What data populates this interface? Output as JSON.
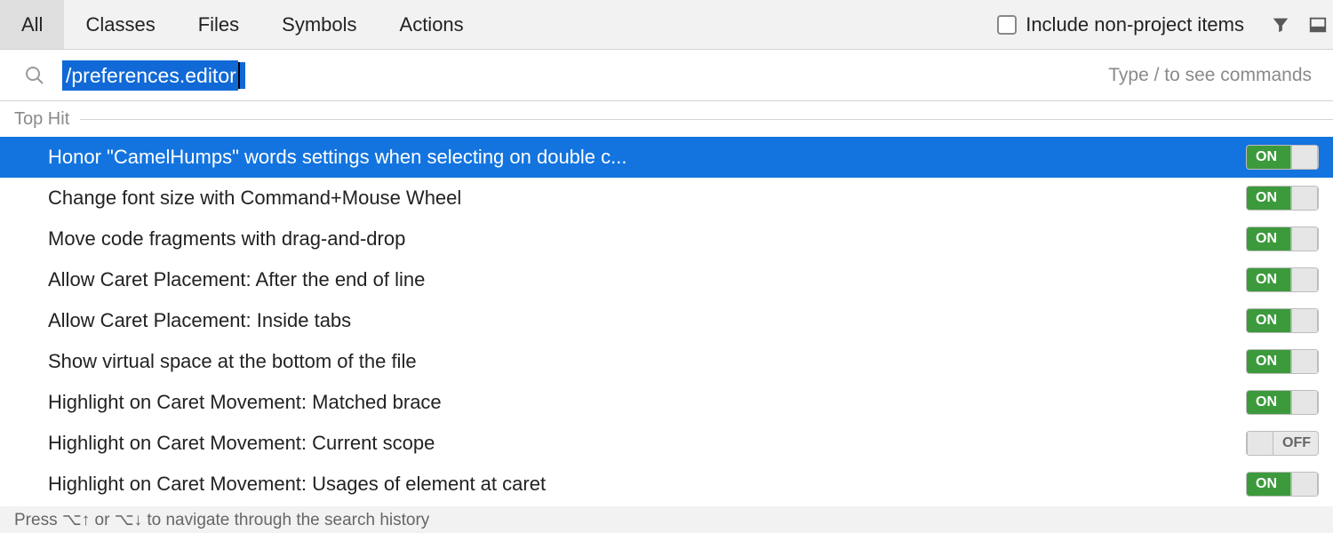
{
  "tabs": [
    "All",
    "Classes",
    "Files",
    "Symbols",
    "Actions"
  ],
  "active_tab": 0,
  "include": {
    "label": "Include non-project items",
    "checked": false
  },
  "search": {
    "query": "/preferences.editor",
    "hint": "Type / to see commands"
  },
  "section": "Top Hit",
  "results": [
    {
      "label": "Honor \"CamelHumps\" words settings when selecting on double c...",
      "state": "ON",
      "selected": true
    },
    {
      "label": "Change font size with Command+Mouse Wheel",
      "state": "ON",
      "selected": false
    },
    {
      "label": "Move code fragments with drag-and-drop",
      "state": "ON",
      "selected": false
    },
    {
      "label": "Allow Caret Placement: After the end of line",
      "state": "ON",
      "selected": false
    },
    {
      "label": "Allow Caret Placement: Inside tabs",
      "state": "ON",
      "selected": false
    },
    {
      "label": "Show virtual space at the bottom of the file",
      "state": "ON",
      "selected": false
    },
    {
      "label": "Highlight on Caret Movement: Matched brace",
      "state": "ON",
      "selected": false
    },
    {
      "label": "Highlight on Caret Movement: Current scope",
      "state": "OFF",
      "selected": false
    },
    {
      "label": "Highlight on Caret Movement: Usages of element at caret",
      "state": "ON",
      "selected": false
    }
  ],
  "status": "Press ⌥↑ or ⌥↓ to navigate through the search history"
}
